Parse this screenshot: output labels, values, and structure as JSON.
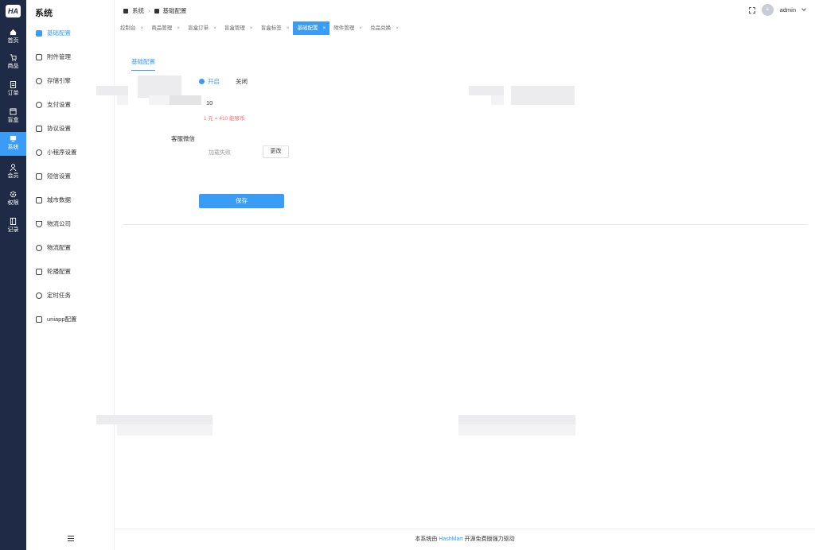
{
  "rail": {
    "logo": "HA",
    "items": [
      {
        "label": "首页",
        "icon": "home-icon"
      },
      {
        "label": "商品",
        "icon": "cart-icon"
      },
      {
        "label": "订单",
        "icon": "order-icon"
      },
      {
        "label": "盲盒",
        "icon": "box-icon"
      },
      {
        "label": "系统",
        "icon": "monitor-icon"
      },
      {
        "label": "会员",
        "icon": "user-icon"
      },
      {
        "label": "权限",
        "icon": "gear-icon"
      },
      {
        "label": "记录",
        "icon": "record-icon"
      }
    ]
  },
  "sidebar": {
    "title": "系统",
    "items": [
      {
        "label": "基础配置"
      },
      {
        "label": "附件管理"
      },
      {
        "label": "存储引擎"
      },
      {
        "label": "支付设置"
      },
      {
        "label": "协议设置"
      },
      {
        "label": "小程序设置"
      },
      {
        "label": "短信设置"
      },
      {
        "label": "城市数据"
      },
      {
        "label": "物流公司"
      },
      {
        "label": "物流配置"
      },
      {
        "label": "轮播配置"
      },
      {
        "label": "定时任务"
      },
      {
        "label": "uniapp配置"
      }
    ]
  },
  "breadcrumb": {
    "first": "系统",
    "second": "基础配置"
  },
  "header": {
    "user": "admin",
    "avatar_text": "a"
  },
  "tabs": [
    {
      "label": "控制台"
    },
    {
      "label": "商品管理"
    },
    {
      "label": "盲盒订单"
    },
    {
      "label": "盲盒管理"
    },
    {
      "label": "盲盒标签"
    },
    {
      "label": "基础配置"
    },
    {
      "label": "附件管理"
    },
    {
      "label": "兑品兑换"
    }
  ],
  "tab_close": "×",
  "content": {
    "tab_label": "基础配置",
    "radio_on": "开启",
    "radio_off": "关闭",
    "number_value": "10",
    "hint": "1 元 = 410 能够币",
    "wechat_label": "客服微信",
    "load_fail": "加载失败",
    "change_button": "更改",
    "save_button": "保存"
  },
  "footer": {
    "prefix": "本系统由 ",
    "brand": "HashMart",
    "suffix": " 开源免费版强力驱动"
  },
  "colors": {
    "accent": "#3b9cf5",
    "rail": "#1f2b46",
    "hint": "#f56c6c"
  }
}
